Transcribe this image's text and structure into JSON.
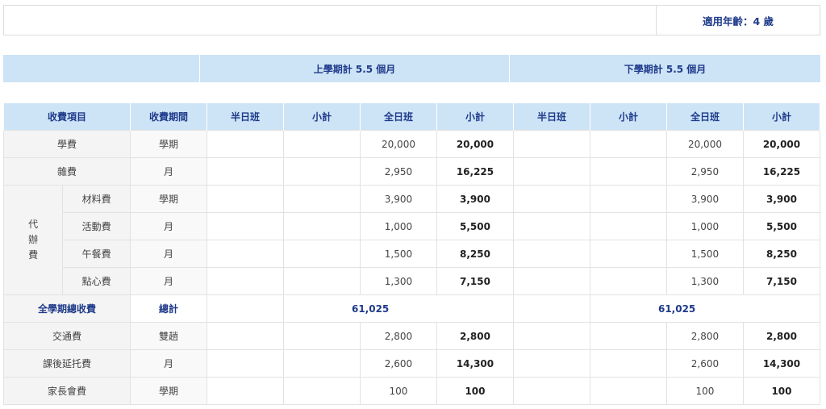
{
  "age_label": "適用年齡：4 歲",
  "semesters": {
    "first": "上學期計 5.5 個月",
    "second": "下學期計 5.5 個月"
  },
  "headers": {
    "item": "收費項目",
    "period": "收費期間",
    "half_day": "半日班",
    "subtotal": "小計",
    "full_day": "全日班"
  },
  "rows": {
    "tuition": {
      "name": "學費",
      "period": "學期",
      "full": "20,000",
      "subtotal": "20,000"
    },
    "misc": {
      "name": "雜費",
      "period": "月",
      "full": "2,950",
      "subtotal": "16,225"
    },
    "agency_group": "代\n辦\n費",
    "materials": {
      "name": "材料費",
      "period": "學期",
      "full": "3,900",
      "subtotal": "3,900"
    },
    "activity": {
      "name": "活動費",
      "period": "月",
      "full": "1,000",
      "subtotal": "5,500"
    },
    "lunch": {
      "name": "午餐費",
      "period": "月",
      "full": "1,500",
      "subtotal": "8,250"
    },
    "snack": {
      "name": "點心費",
      "period": "月",
      "full": "1,300",
      "subtotal": "7,150"
    },
    "total": {
      "name": "全學期總收費",
      "period": "總計",
      "first_total": "61,025",
      "second_total": "61,025"
    },
    "transport": {
      "name": "交通費",
      "period": "雙趟",
      "full": "2,800",
      "subtotal": "2,800"
    },
    "afterschool": {
      "name": "課後延托費",
      "period": "月",
      "full": "2,600",
      "subtotal": "14,300"
    },
    "parents": {
      "name": "家長會費",
      "period": "學期",
      "full": "100",
      "subtotal": "100"
    }
  },
  "colors": {
    "header_bg": "#cde4f7",
    "header_text": "#1f3a8a",
    "label_bg": "#f4f4f4"
  }
}
